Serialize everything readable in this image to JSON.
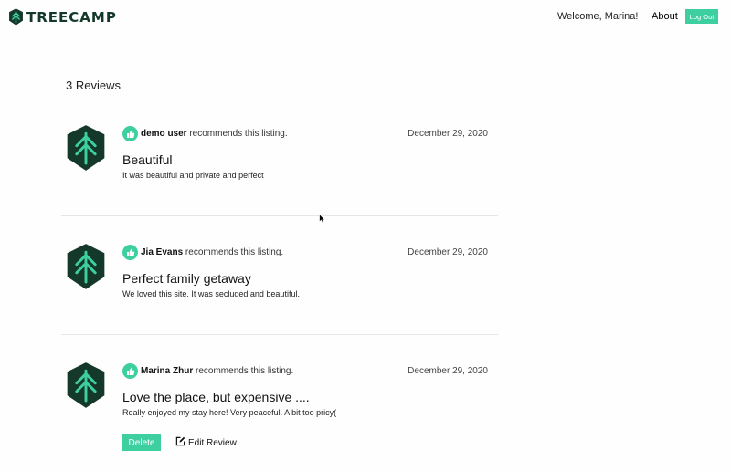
{
  "header": {
    "logo_text": "TREECAMP",
    "welcome": "Welcome, Marina!",
    "about": "About",
    "logout": "Log Out"
  },
  "reviews_count": "3 Reviews",
  "reviews": [
    {
      "reviewer": "demo user",
      "recommend_text": " recommends this listing.",
      "date": "December 29, 2020",
      "title": "Beautiful",
      "body": "It was beautiful and private and perfect"
    },
    {
      "reviewer": "Jia Evans",
      "recommend_text": " recommends this listing.",
      "date": "December 29, 2020",
      "title": "Perfect family getaway",
      "body": "We loved this site. It was secluded and beautiful."
    },
    {
      "reviewer": "Marina Zhur",
      "recommend_text": " recommends this listing.",
      "date": "December 29, 2020",
      "title": "Love the place, but expensive ....",
      "body": "Really enjoyed my stay here! Very peaceful. A bit too pricy(",
      "delete_label": "Delete",
      "edit_label": "Edit Review"
    }
  ],
  "colors": {
    "accent": "#3ecfa0",
    "brand_dark": "#14392a",
    "avatar_arrow": "#3ecfa0"
  },
  "icons": {
    "logo": "tree-arrow-logo-icon",
    "avatar": "tree-arrow-avatar-icon",
    "recommend": "thumbs-up-icon",
    "edit": "edit-pencil-icon",
    "cursor": "mouse-pointer-icon"
  }
}
